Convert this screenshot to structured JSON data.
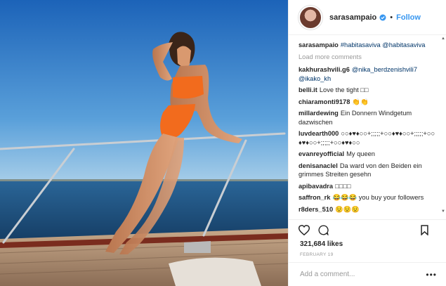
{
  "post": {
    "username": "sarasampaio",
    "separator": "•",
    "follow_label": "Follow",
    "caption": {
      "user": "sarasampaio",
      "text": "#habitasaviva @habitasaviva"
    },
    "load_more": "Load more comments",
    "comments": [
      {
        "user": "kakhurashvili.g6",
        "text": "@nika_berdzenishvili7 @ikako_kh"
      },
      {
        "user": "belli.it",
        "text": "Love the tight □□"
      },
      {
        "user": "chiaramonti9178",
        "text": "👏👏"
      },
      {
        "user": "millardewing",
        "text": "Ein Donnern Windgetum dazwischen"
      },
      {
        "user": "luvdearth000",
        "text": "○○♦♥♦○○+;;;;;+○○♦♥♦○○+;;;;;+○○♦♥♦○○+;;;;;+○○♦♥♦○○"
      },
      {
        "user": "evanreyofficial",
        "text": "My queen"
      },
      {
        "user": "denisanaclel",
        "text": "Da ward von den Beiden ein grimmes Streiten gesehn"
      },
      {
        "user": "apibavadra",
        "text": "□□□□"
      },
      {
        "user": "saffron_rk",
        "text": "😂😂😂 you buy your followers"
      },
      {
        "user": "r8ders_510",
        "text": "😟😟😟"
      },
      {
        "user": "...",
        "text": ""
      }
    ],
    "likes": "321,684 likes",
    "date": "FEBRUARY 19",
    "comment_placeholder": "Add a comment...",
    "more_menu": "•••"
  },
  "icons": {
    "like": "heart-outline-icon",
    "comment": "speech-bubble-icon",
    "save": "bookmark-icon",
    "verified": "verified-badge-icon"
  },
  "colors": {
    "link": "#003569",
    "follow": "#3897f0",
    "verified": "#3897f0",
    "muted": "#999999",
    "sky": "#2a78c8",
    "sea": "#1c4e7d",
    "swimsuit": "#f26b1d"
  }
}
